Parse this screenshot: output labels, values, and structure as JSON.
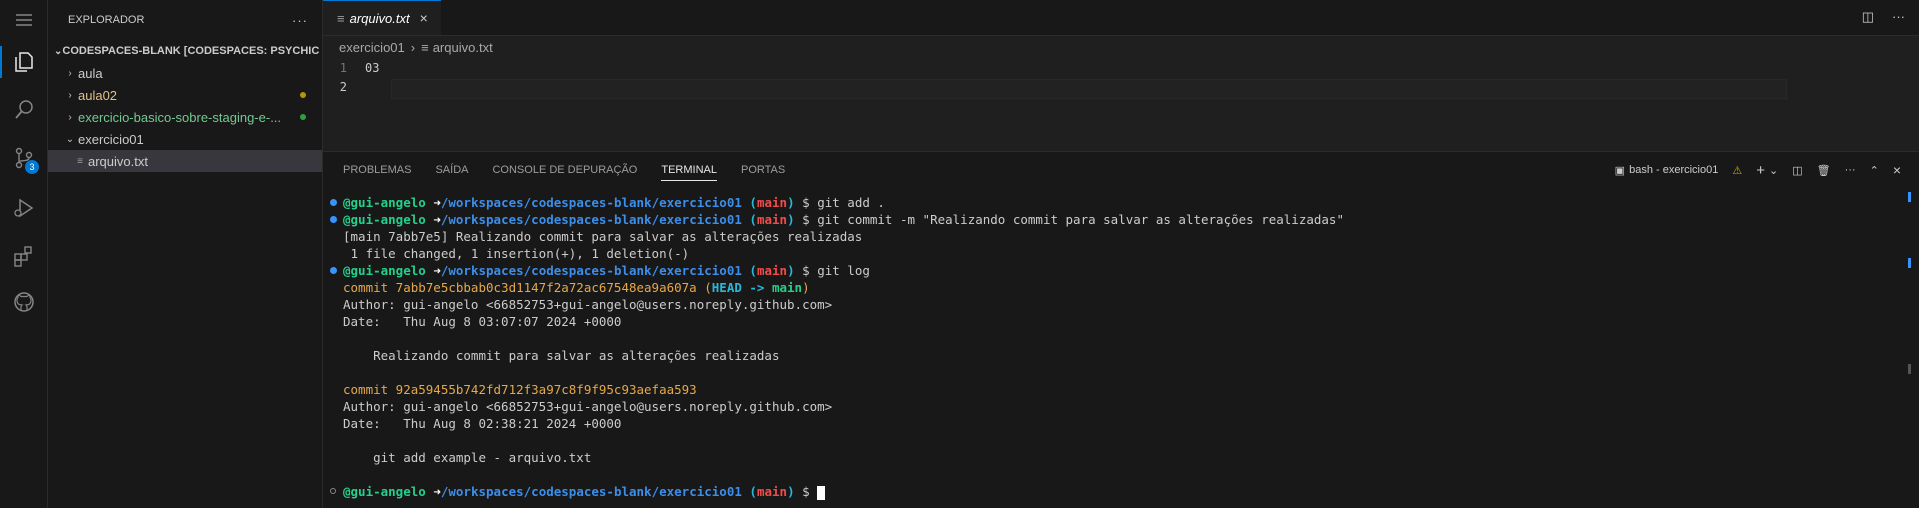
{
  "explorer": {
    "title": "EXPLORADOR",
    "more": "···",
    "root": "CODESPACES-BLANK [CODESPACES: PSYCHIC S...",
    "items": [
      {
        "label": "aula",
        "color": "#cccccc",
        "chevron": "›"
      },
      {
        "label": "aula02",
        "color": "#e2c08d",
        "chevron": "›",
        "dot": "#b89500"
      },
      {
        "label": "exercicio-basico-sobre-staging-e-...",
        "color": "#73c991",
        "chevron": "›",
        "dot": "#2ea043"
      },
      {
        "label": "exercicio01",
        "color": "#cccccc",
        "chevron": "⌄"
      },
      {
        "label": "arquivo.txt",
        "color": "#cccccc",
        "icon": "≡"
      }
    ]
  },
  "activity": {
    "scm_badge": "3"
  },
  "editor": {
    "tab_label": "arquivo.txt",
    "tab_close": "×",
    "breadcrumb": {
      "folder": "exercicio01",
      "sep": "›",
      "file": "arquivo.txt"
    },
    "lines": [
      {
        "num": "1",
        "text": "03"
      },
      {
        "num": "2",
        "text": ""
      }
    ]
  },
  "panel": {
    "tabs": [
      "PROBLEMAS",
      "SAÍDA",
      "CONSOLE DE DEPURAÇÃO",
      "TERMINAL",
      "PORTAS"
    ],
    "active_tab": "TERMINAL",
    "terminal_name": "bash - exercicio01",
    "add": "+",
    "more": "···"
  },
  "terminal": {
    "user": "@gui-angelo",
    "arrow": "➜",
    "path": "/workspaces/codespaces-blank/exercicio01",
    "branch_open": "(",
    "branch": "main",
    "branch_close": ")",
    "prompt": "$",
    "cmd1": "git add .",
    "cmd2": "git commit -m \"Realizando commit para salvar as alterações realizadas\"",
    "out1": "[main 7abb7e5] Realizando commit para salvar as alterações realizadas",
    "out2": " 1 file changed, 1 insertion(+), 1 deletion(-)",
    "cmd3": "git log",
    "commit1_prefix": "commit 7abb7e5cbbab0c3d1147f2a72ac67548ea9a607a (",
    "head": "HEAD -> ",
    "head_branch": "main",
    "commit1_suffix": ")",
    "author1": "Author: gui-angelo <66852753+gui-angelo@users.noreply.github.com>",
    "date1": "Date:   Thu Aug 8 03:07:07 2024 +0000",
    "msg1": "    Realizando commit para salvar as alterações realizadas",
    "commit2": "commit 92a59455b742fd712f3a97c8f9f95c93aefaa593",
    "author2": "Author: gui-angelo <66852753+gui-angelo@users.noreply.github.com>",
    "date2": "Date:   Thu Aug 8 02:38:21 2024 +0000",
    "msg2": "    git add example - arquivo.txt"
  }
}
